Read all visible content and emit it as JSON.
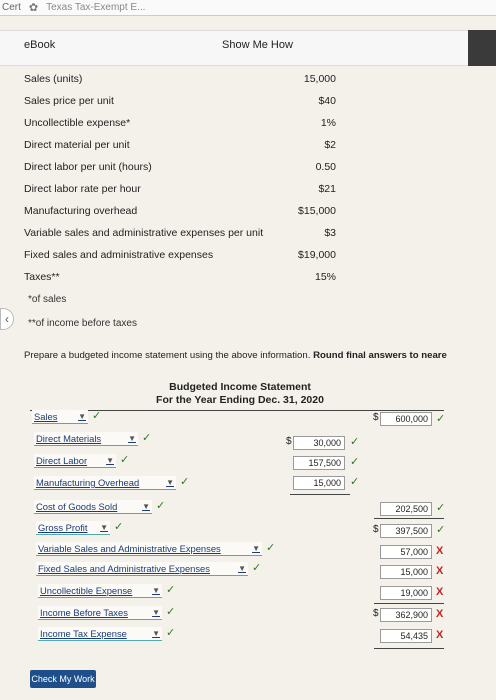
{
  "browser": {
    "left_text": "Cert",
    "tab_title": "Texas Tax-Exempt E..."
  },
  "toolbar": {
    "ebook": "eBook",
    "show_me_how": "Show Me How"
  },
  "params": [
    {
      "label": "Sales (units)",
      "value": "15,000"
    },
    {
      "label": "Sales price per unit",
      "value": "$40"
    },
    {
      "label": "Uncollectible expense*",
      "value": "1%"
    },
    {
      "label": "Direct material per unit",
      "value": "$2"
    },
    {
      "label": "Direct labor per unit (hours)",
      "value": "0.50"
    },
    {
      "label": "Direct labor rate per hour",
      "value": "$21"
    },
    {
      "label": "Manufacturing overhead",
      "value": "$15,000"
    },
    {
      "label": "Variable sales and administrative expenses per unit",
      "value": "$3"
    },
    {
      "label": "Fixed sales and administrative expenses",
      "value": "$19,000"
    },
    {
      "label": "Taxes**",
      "value": "15%"
    }
  ],
  "notes": {
    "sales": "*of sales",
    "income": "**of income before taxes"
  },
  "instructions": {
    "text": "Prepare a budgeted income statement using the above information. ",
    "bold": "Round final answers to neare"
  },
  "statement": {
    "title": "Budgeted Income Statement",
    "subtitle": "For the Year Ending Dec. 31, 2020",
    "rows": {
      "sales": {
        "label": "Sales",
        "value": "600,000",
        "status": "correct"
      },
      "direct_materials": {
        "label": "Direct Materials",
        "value": "30,000",
        "status": "correct"
      },
      "direct_labor": {
        "label": "Direct Labor",
        "value": "157,500",
        "status": "correct"
      },
      "manufacturing_overhead": {
        "label": "Manufacturing Overhead",
        "value": "15,000",
        "status": "correct"
      },
      "cost_of_goods_sold": {
        "label": "Cost of Goods Sold",
        "value": "202,500",
        "status": "correct"
      },
      "gross_profit": {
        "label": "Gross Profit",
        "value": "397,500",
        "status": "correct"
      },
      "variable_sa": {
        "label": "Variable Sales and Administrative Expenses",
        "value": "57,000",
        "status": "incorrect"
      },
      "fixed_sa": {
        "label": "Fixed Sales and Administrative Expenses",
        "value": "15,000",
        "status": "incorrect"
      },
      "uncollectible": {
        "label": "Uncollectible Expense",
        "value": "19,000",
        "status": "incorrect"
      },
      "income_before_taxes": {
        "label": "Income Before Taxes",
        "value": "362,900",
        "status": "incorrect"
      },
      "income_tax_expense": {
        "label": "Income Tax Expense",
        "value": "54,435",
        "status": "incorrect"
      }
    },
    "currency": "$"
  },
  "marks": {
    "check": "✓",
    "cross": "X"
  },
  "buttons": {
    "check_my_work": "Check My Work"
  }
}
